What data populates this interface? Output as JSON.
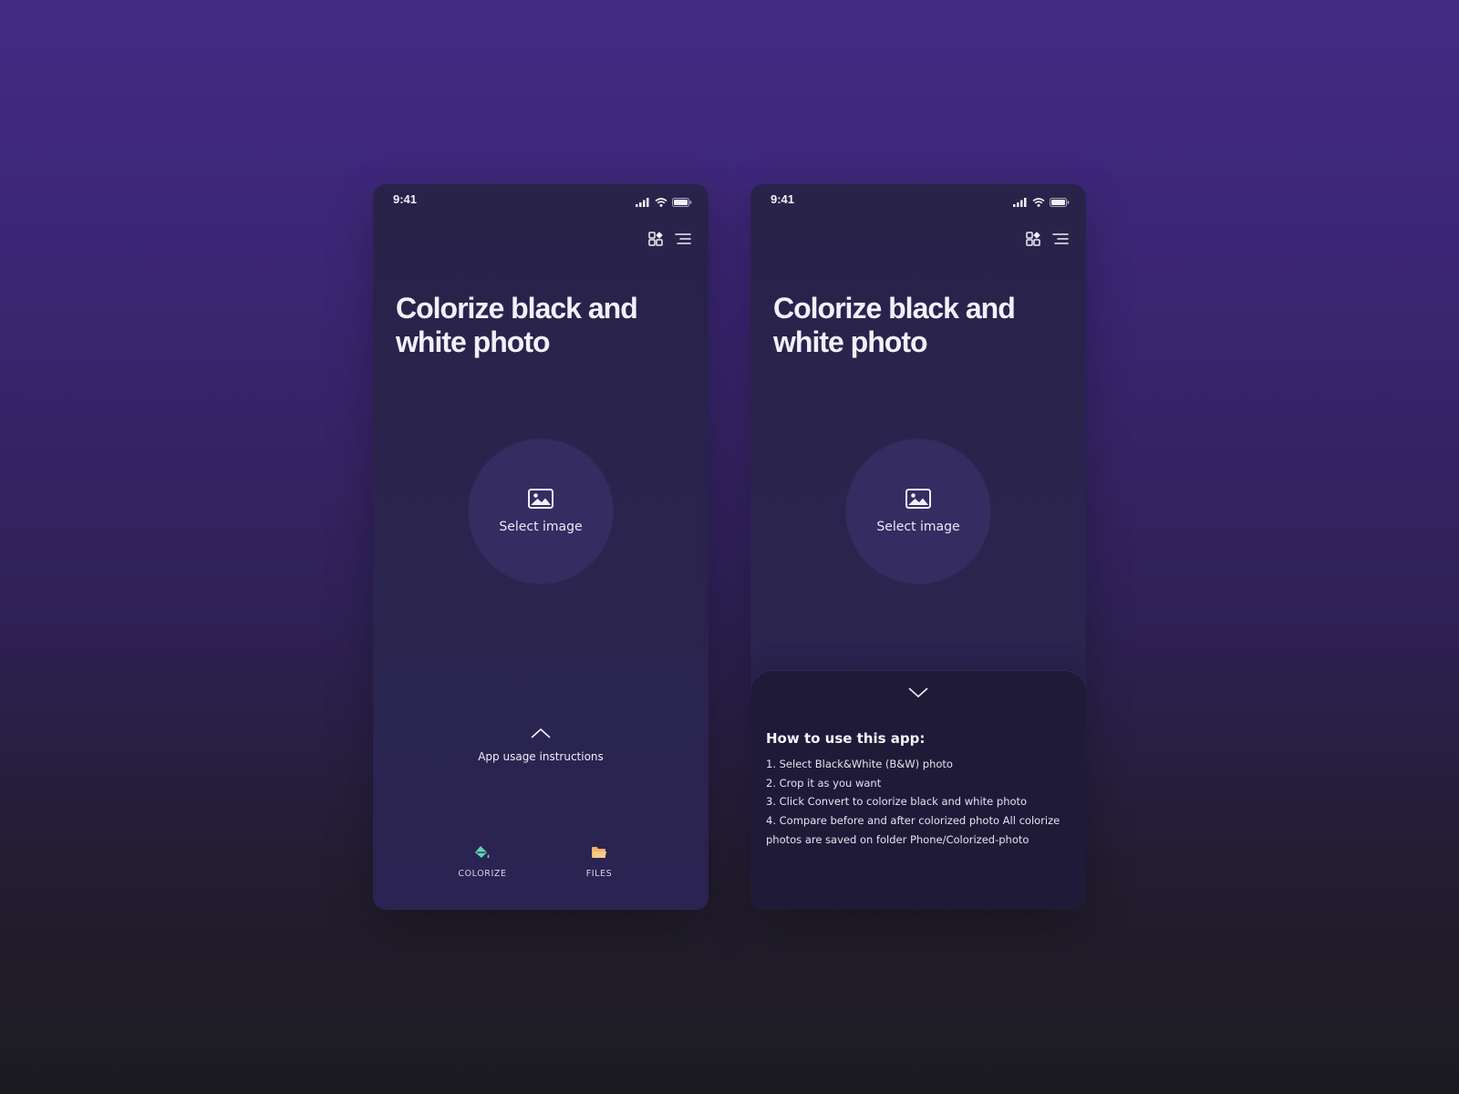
{
  "colors": {
    "accent_colorize": "#5fd3b5",
    "accent_files": "#f3b46a"
  },
  "screens": [
    {
      "status_time": "9:41",
      "title": "Colorize black and white photo",
      "select_label": "Select image",
      "instructions_label": "App usage instructions",
      "nav": [
        {
          "label": "COLORIZE",
          "icon": "paint-bucket-icon"
        },
        {
          "label": "FILES",
          "icon": "folder-icon"
        }
      ]
    },
    {
      "status_time": "9:41",
      "title": "Colorize black and white photo",
      "select_label": "Select image",
      "sheet": {
        "title": "How to use this app:",
        "steps": [
          "1. Select Black&White (B&W) photo",
          "2. Crop it as you want",
          "3. Click Convert to colorize black and white photo",
          "4. Compare before and after colorized photo All colorize photos are saved on folder Phone/Colorized-photo"
        ]
      }
    }
  ]
}
